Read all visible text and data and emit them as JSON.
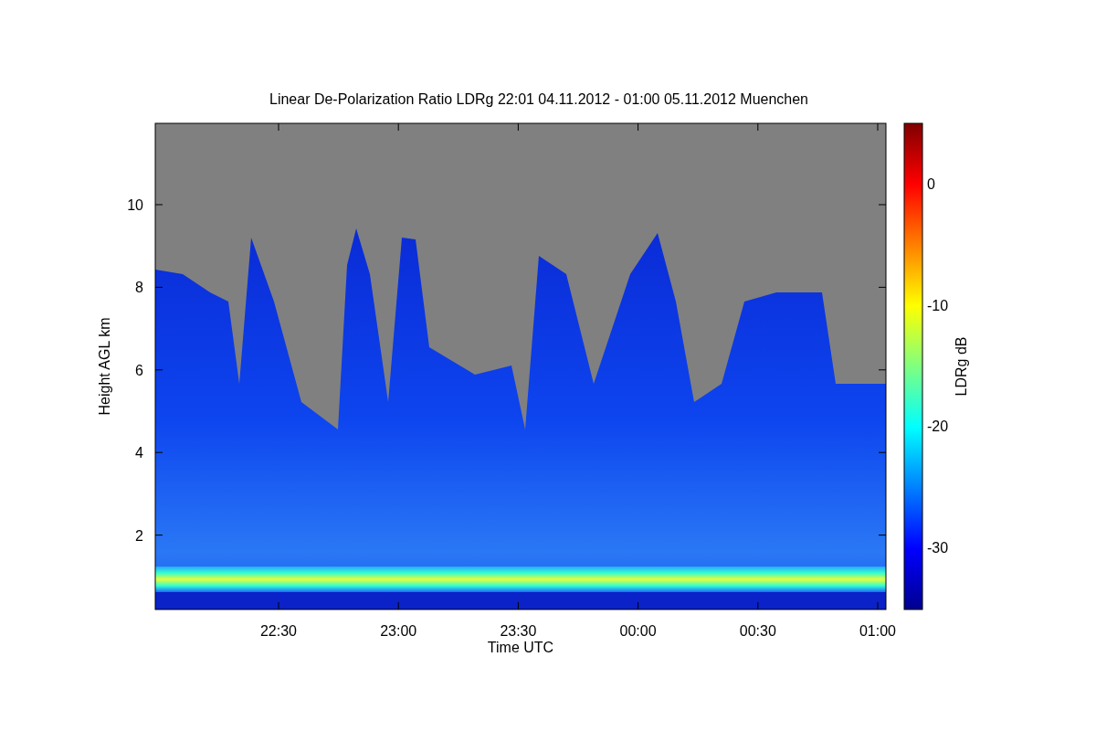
{
  "chart": {
    "title": "Linear De-Polarization Ratio LDRg   22:01 04.11.2012 - 01:00 05.11.2012 Muenchen",
    "ylabel": "Height AGL km",
    "xlabel": "Time UTC",
    "y_tick_labels": [
      "10",
      "8",
      "6",
      "4",
      "2"
    ],
    "x_tick_labels": [
      "22:30",
      "23:00",
      "23:30",
      "00:00",
      "00:30",
      "01:00"
    ],
    "colorbar": {
      "label": "LDRg dB",
      "tick_labels": [
        "0",
        "-10",
        "-20",
        "-30"
      ]
    }
  }
}
